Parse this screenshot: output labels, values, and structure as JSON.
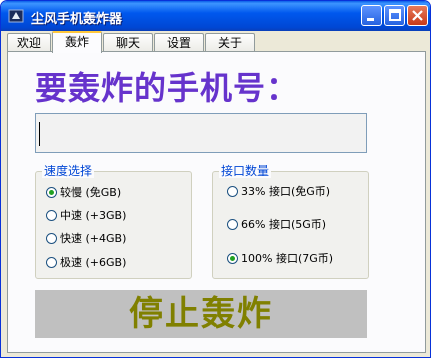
{
  "window": {
    "title": "尘风手机轰炸器",
    "controls": {
      "minimize": "minimize",
      "maximize": "maximize",
      "close": "close"
    }
  },
  "tabs": [
    {
      "label": "欢迎",
      "active": false
    },
    {
      "label": "轰炸",
      "active": true
    },
    {
      "label": "聊天",
      "active": false
    },
    {
      "label": "设置",
      "active": false
    },
    {
      "label": "关于",
      "active": false
    }
  ],
  "main": {
    "heading": "要轰炸的手机号：",
    "phone_value": "",
    "speed_group": {
      "title": "速度选择",
      "options": [
        {
          "label": "较慢 (免GB)",
          "selected": true
        },
        {
          "label": "中速 (+3GB)",
          "selected": false
        },
        {
          "label": "快速 (+4GB)",
          "selected": false
        },
        {
          "label": "极速 (+6GB)",
          "selected": false
        }
      ]
    },
    "port_group": {
      "title": "接口数量",
      "options": [
        {
          "label": "33% 接口(免G币)",
          "selected": false
        },
        {
          "label": "66% 接口(5G币)",
          "selected": false
        },
        {
          "label": "100% 接口(7G币)",
          "selected": true
        }
      ]
    },
    "stop_button": "停止轰炸"
  },
  "colors": {
    "heading": "#6633cc",
    "group_title": "#0046d5",
    "stop_text": "#808000",
    "stop_bg": "#c0c0c0",
    "radio_dot": "#21a121"
  }
}
